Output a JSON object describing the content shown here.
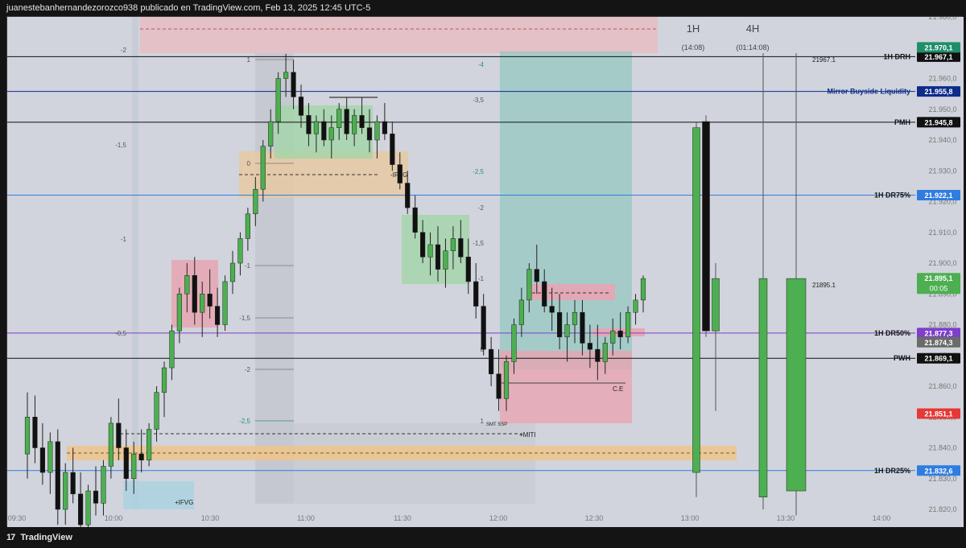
{
  "header": {
    "title": "juanestebanhernandezorozco938 publicado en TradingView.com, Feb 13, 2025 12:45 UTC-5"
  },
  "footer": {
    "brand": "TradingView",
    "brand_icon": "tradingview-logo-icon"
  },
  "colors": {
    "bull": "#4caf50",
    "bear": "#111111",
    "drh": "#1f8f6a",
    "dark": "#111111",
    "mirror": "#0d2b8a",
    "dr75": "#2f7de1",
    "dr50": "#7e3fc9",
    "gray": "#6b6b6b",
    "red_label": "#e53935",
    "dr25": "#2f7de1"
  },
  "chart_data": {
    "type": "candlestick",
    "title": "",
    "xlabel": "",
    "ylabel": "",
    "ylim": [
      21820,
      21980
    ],
    "x_ticks": [
      "09:30",
      "10:00",
      "10:30",
      "11:00",
      "11:30",
      "12:00",
      "12:30",
      "13:00",
      "13:30",
      "14:00"
    ],
    "y_ticks": [
      "21.980,0",
      "21.970,0",
      "21.960,0",
      "21.950,0",
      "21.940,0",
      "21.930,0",
      "21.920,0",
      "21.910,0",
      "21.900,0",
      "21.890,0",
      "21.880,0",
      "21.870,0",
      "21.860,0",
      "21.850,0",
      "21.840,0",
      "21.830,0",
      "21.820,0"
    ],
    "timeframe_labels": [
      {
        "tf": "1H",
        "countdown": "(14:08)"
      },
      {
        "tf": "4H",
        "countdown": "(01:14:08)"
      }
    ],
    "price_lines": [
      {
        "name": "1H DRH",
        "price": 21967.1,
        "price_label": "21.967,1",
        "color_key": "dark"
      },
      {
        "name": "Mirror Buyside Liquidity",
        "price": 21955.8,
        "price_label": "21.955,8",
        "color_key": "mirror"
      },
      {
        "name": "PMH",
        "price": 21945.8,
        "price_label": "21.945,8",
        "color_key": "dark"
      },
      {
        "name": "1H DR75%",
        "price": 21922.1,
        "price_label": "21.922,1",
        "color_key": "dr75"
      },
      {
        "name": "1H DR50%",
        "price": 21877.3,
        "price_label": "21.877,3",
        "color_key": "dr50"
      },
      {
        "name": "PWH",
        "price": 21869.1,
        "price_label": "21.869,1",
        "color_key": "dark"
      },
      {
        "name": "1H DR25%",
        "price": 21832.6,
        "price_label": "21.832,6",
        "color_key": "dr25"
      }
    ],
    "extra_price_labels": [
      {
        "price": 21970.1,
        "label": "21.970,1",
        "color_key": "drh"
      },
      {
        "price": 21895.1,
        "label": "21.895,1",
        "sub": "00:05",
        "color_key": "bull"
      },
      {
        "price": 21874.3,
        "label": "21.874,3",
        "color_key": "gray"
      },
      {
        "price": 21851.1,
        "label": "21.851,1",
        "color_key": "red_label"
      }
    ],
    "annotations": [
      {
        "text": "21967.1",
        "price": 21967.1
      },
      {
        "text": "21895.1",
        "price": 21895.1
      },
      {
        "text": "-IFVG",
        "price": 21928
      },
      {
        "text": "+IFVG",
        "price": 21821
      },
      {
        "text": "+MITI",
        "price": 21846
      },
      {
        "text": "C.E",
        "price": 21862
      },
      {
        "text": "SMT SSP",
        "price": 21850
      }
    ],
    "fib_labels": {
      "left": [
        "-2",
        "-1,5",
        "-1",
        "-0,5"
      ],
      "mid": [
        "1",
        "0",
        "-1",
        "-1,5",
        "-2",
        "-2,5"
      ],
      "right": [
        "-4",
        "-3,5",
        "-2,5",
        "-2",
        "-1,5",
        "-1",
        "0",
        "1"
      ]
    },
    "candles": [
      [
        21838,
        21858,
        21830,
        21850
      ],
      [
        21850,
        21857,
        21835,
        21840
      ],
      [
        21840,
        21848,
        21828,
        21832
      ],
      [
        21832,
        21845,
        21825,
        21842
      ],
      [
        21842,
        21846,
        21815,
        21820
      ],
      [
        21820,
        21835,
        21815,
        21832
      ],
      [
        21832,
        21840,
        21822,
        21825
      ],
      [
        21825,
        21832,
        21810,
        21815
      ],
      [
        21815,
        21828,
        21812,
        21826
      ],
      [
        21826,
        21834,
        21818,
        21822
      ],
      [
        21822,
        21836,
        21818,
        21834
      ],
      [
        21834,
        21850,
        21830,
        21848
      ],
      [
        21848,
        21856,
        21836,
        21840
      ],
      [
        21840,
        21846,
        21826,
        21830
      ],
      [
        21830,
        21842,
        21825,
        21838
      ],
      [
        21838,
        21846,
        21832,
        21836
      ],
      [
        21836,
        21848,
        21834,
        21846
      ],
      [
        21846,
        21860,
        21842,
        21858
      ],
      [
        21858,
        21868,
        21850,
        21866
      ],
      [
        21866,
        21880,
        21862,
        21878
      ],
      [
        21878,
        21892,
        21874,
        21890
      ],
      [
        21890,
        21900,
        21884,
        21896
      ],
      [
        21896,
        21902,
        21880,
        21884
      ],
      [
        21884,
        21894,
        21876,
        21890
      ],
      [
        21890,
        21898,
        21882,
        21886
      ],
      [
        21886,
        21892,
        21876,
        21880
      ],
      [
        21880,
        21896,
        21878,
        21894
      ],
      [
        21894,
        21904,
        21890,
        21900
      ],
      [
        21900,
        21910,
        21896,
        21908
      ],
      [
        21908,
        21918,
        21904,
        21916
      ],
      [
        21916,
        21928,
        21912,
        21924
      ],
      [
        21924,
        21940,
        21920,
        21938
      ],
      [
        21938,
        21950,
        21934,
        21946
      ],
      [
        21946,
        21962,
        21942,
        21960
      ],
      [
        21960,
        21968,
        21954,
        21962
      ],
      [
        21962,
        21966,
        21950,
        21954
      ],
      [
        21954,
        21958,
        21944,
        21948
      ],
      [
        21948,
        21952,
        21938,
        21942
      ],
      [
        21942,
        21948,
        21936,
        21946
      ],
      [
        21946,
        21950,
        21938,
        21940
      ],
      [
        21940,
        21948,
        21934,
        21944
      ],
      [
        21944,
        21952,
        21940,
        21950
      ],
      [
        21950,
        21954,
        21940,
        21942
      ],
      [
        21942,
        21950,
        21938,
        21948
      ],
      [
        21948,
        21954,
        21942,
        21944
      ],
      [
        21944,
        21950,
        21936,
        21940
      ],
      [
        21940,
        21948,
        21934,
        21946
      ],
      [
        21946,
        21952,
        21940,
        21942
      ],
      [
        21942,
        21946,
        21930,
        21932
      ],
      [
        21932,
        21936,
        21924,
        21926
      ],
      [
        21926,
        21930,
        21916,
        21918
      ],
      [
        21918,
        21922,
        21908,
        21910
      ],
      [
        21910,
        21914,
        21900,
        21902
      ],
      [
        21902,
        21910,
        21896,
        21906
      ],
      [
        21906,
        21912,
        21894,
        21898
      ],
      [
        21898,
        21908,
        21892,
        21904
      ],
      [
        21904,
        21912,
        21898,
        21908
      ],
      [
        21908,
        21914,
        21900,
        21902
      ],
      [
        21902,
        21908,
        21890,
        21894
      ],
      [
        21894,
        21900,
        21882,
        21886
      ],
      [
        21886,
        21890,
        21870,
        21872
      ],
      [
        21872,
        21876,
        21860,
        21864
      ],
      [
        21864,
        21872,
        21852,
        21856
      ],
      [
        21856,
        21870,
        21852,
        21868
      ],
      [
        21868,
        21882,
        21864,
        21880
      ],
      [
        21880,
        21892,
        21876,
        21888
      ],
      [
        21888,
        21900,
        21884,
        21898
      ],
      [
        21898,
        21906,
        21890,
        21894
      ],
      [
        21894,
        21898,
        21884,
        21886
      ],
      [
        21886,
        21892,
        21878,
        21884
      ],
      [
        21884,
        21890,
        21872,
        21876
      ],
      [
        21876,
        21884,
        21868,
        21880
      ],
      [
        21880,
        21888,
        21874,
        21884
      ],
      [
        21884,
        21888,
        21870,
        21874
      ],
      [
        21874,
        21880,
        21866,
        21872
      ],
      [
        21872,
        21880,
        21862,
        21868
      ],
      [
        21868,
        21876,
        21864,
        21874
      ],
      [
        21874,
        21882,
        21870,
        21878
      ],
      [
        21878,
        21884,
        21872,
        21876
      ],
      [
        21876,
        21886,
        21874,
        21884
      ],
      [
        21884,
        21890,
        21880,
        21888
      ],
      [
        21888,
        21896,
        21884,
        21895
      ]
    ],
    "htf_candles_1h": [
      [
        21832,
        21946,
        21824,
        21944
      ],
      [
        21946,
        21948,
        21876,
        21878
      ],
      [
        21878,
        21900,
        21852,
        21895
      ]
    ],
    "htf_candles_4h": [
      [
        21824,
        21895,
        21820,
        21895
      ],
      [
        21826,
        21895,
        21818,
        21895
      ]
    ]
  }
}
